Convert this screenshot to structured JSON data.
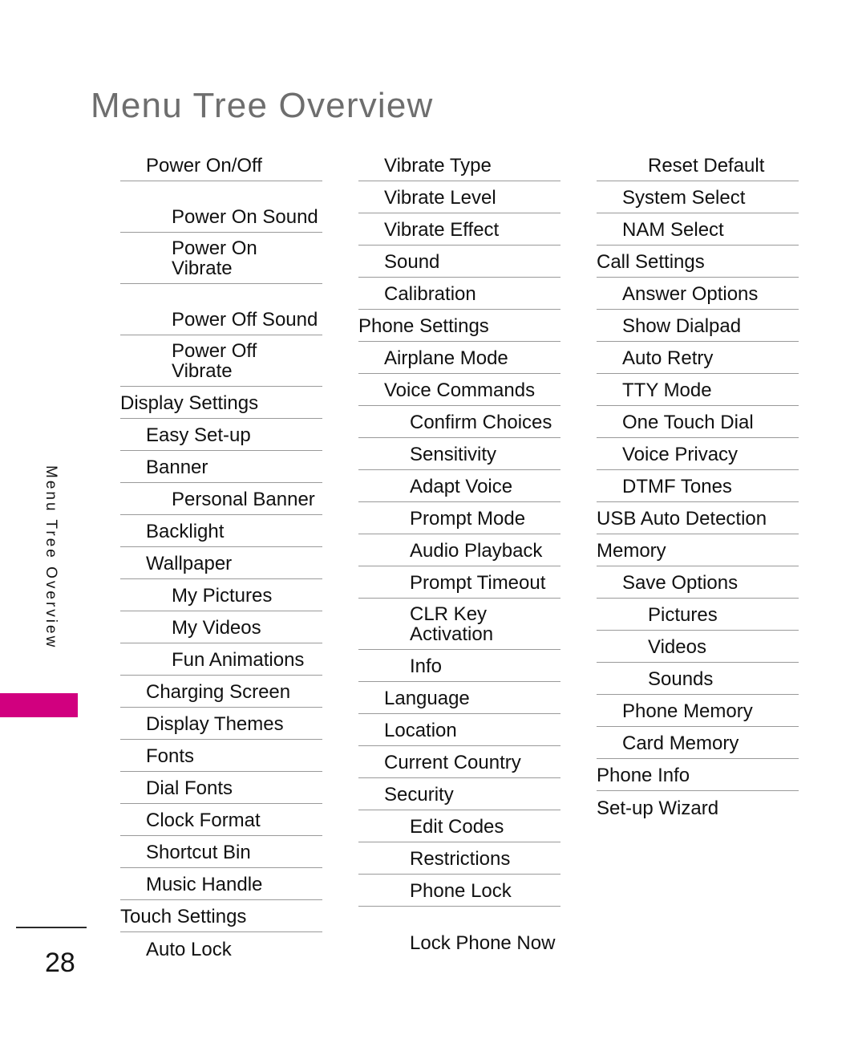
{
  "page": {
    "title": "Menu Tree Overview",
    "number": "28",
    "sidebar_label": "Menu Tree Overview",
    "accent_color": "#d1007f",
    "title_color": "#6e6e6e",
    "rule_color": "#9a9a9a"
  },
  "columns": [
    {
      "name": "column-1",
      "items": [
        {
          "label": "Power On/Off",
          "level": 1,
          "lines": 1
        },
        {
          "label": "Power On Sound",
          "level": 2,
          "lines": 2
        },
        {
          "label": "Power On Vibrate",
          "level": 2,
          "lines": 2
        },
        {
          "label": "Power Off Sound",
          "level": 2,
          "lines": 2
        },
        {
          "label": "Power Off Vibrate",
          "level": 2,
          "lines": 2
        },
        {
          "label": "Display Settings",
          "level": 0,
          "lines": 1
        },
        {
          "label": "Easy Set-up",
          "level": 1,
          "lines": 1
        },
        {
          "label": "Banner",
          "level": 1,
          "lines": 1
        },
        {
          "label": "Personal Banner",
          "level": 2,
          "lines": 1
        },
        {
          "label": "Backlight",
          "level": 1,
          "lines": 1
        },
        {
          "label": "Wallpaper",
          "level": 1,
          "lines": 1
        },
        {
          "label": "My Pictures",
          "level": 2,
          "lines": 1
        },
        {
          "label": "My Videos",
          "level": 2,
          "lines": 1
        },
        {
          "label": "Fun Animations",
          "level": 2,
          "lines": 1
        },
        {
          "label": "Charging Screen",
          "level": 1,
          "lines": 1
        },
        {
          "label": "Display Themes",
          "level": 1,
          "lines": 1
        },
        {
          "label": "Fonts",
          "level": 1,
          "lines": 1
        },
        {
          "label": "Dial Fonts",
          "level": 1,
          "lines": 1
        },
        {
          "label": "Clock Format",
          "level": 1,
          "lines": 1
        },
        {
          "label": "Shortcut Bin",
          "level": 1,
          "lines": 1
        },
        {
          "label": "Music Handle",
          "level": 1,
          "lines": 1
        },
        {
          "label": "Touch Settings",
          "level": 0,
          "lines": 1
        },
        {
          "label": "Auto Lock",
          "level": 1,
          "lines": 1
        }
      ]
    },
    {
      "name": "column-2",
      "items": [
        {
          "label": "Vibrate Type",
          "level": 1,
          "lines": 1
        },
        {
          "label": "Vibrate Level",
          "level": 1,
          "lines": 1
        },
        {
          "label": "Vibrate Effect",
          "level": 1,
          "lines": 1
        },
        {
          "label": "Sound",
          "level": 1,
          "lines": 1
        },
        {
          "label": "Calibration",
          "level": 1,
          "lines": 1
        },
        {
          "label": "Phone Settings",
          "level": 0,
          "lines": 1
        },
        {
          "label": "Airplane Mode",
          "level": 1,
          "lines": 1
        },
        {
          "label": "Voice Commands",
          "level": 1,
          "lines": 1
        },
        {
          "label": "Confirm Choices",
          "level": 2,
          "lines": 1
        },
        {
          "label": "Sensitivity",
          "level": 2,
          "lines": 1
        },
        {
          "label": "Adapt Voice",
          "level": 2,
          "lines": 1
        },
        {
          "label": "Prompt Mode",
          "level": 2,
          "lines": 1
        },
        {
          "label": "Audio Playback",
          "level": 2,
          "lines": 1
        },
        {
          "label": "Prompt Timeout",
          "level": 2,
          "lines": 1
        },
        {
          "label": "CLR Key Activation",
          "level": 2,
          "lines": 2
        },
        {
          "label": "Info",
          "level": 2,
          "lines": 1
        },
        {
          "label": "Language",
          "level": 1,
          "lines": 1
        },
        {
          "label": "Location",
          "level": 1,
          "lines": 1
        },
        {
          "label": "Current Country",
          "level": 1,
          "lines": 1
        },
        {
          "label": "Security",
          "level": 1,
          "lines": 1
        },
        {
          "label": "Edit Codes",
          "level": 2,
          "lines": 1
        },
        {
          "label": "Restrictions",
          "level": 2,
          "lines": 1
        },
        {
          "label": "Phone Lock",
          "level": 2,
          "lines": 1
        },
        {
          "label": "Lock Phone Now",
          "level": 2,
          "lines": 2
        }
      ]
    },
    {
      "name": "column-3",
      "items": [
        {
          "label": "Reset Default",
          "level": 2,
          "lines": 1
        },
        {
          "label": "System Select",
          "level": 1,
          "lines": 1
        },
        {
          "label": "NAM Select",
          "level": 1,
          "lines": 1
        },
        {
          "label": "Call Settings",
          "level": 0,
          "lines": 1
        },
        {
          "label": "Answer Options",
          "level": 1,
          "lines": 1
        },
        {
          "label": "Show Dialpad",
          "level": 1,
          "lines": 1
        },
        {
          "label": "Auto Retry",
          "level": 1,
          "lines": 1
        },
        {
          "label": "TTY Mode",
          "level": 1,
          "lines": 1
        },
        {
          "label": "One Touch Dial",
          "level": 1,
          "lines": 1
        },
        {
          "label": "Voice Privacy",
          "level": 1,
          "lines": 1
        },
        {
          "label": "DTMF Tones",
          "level": 1,
          "lines": 1
        },
        {
          "label": "USB Auto Detection",
          "level": 0,
          "lines": 1
        },
        {
          "label": "Memory",
          "level": 0,
          "lines": 1
        },
        {
          "label": "Save Options",
          "level": 1,
          "lines": 1
        },
        {
          "label": "Pictures",
          "level": 2,
          "lines": 1
        },
        {
          "label": "Videos",
          "level": 2,
          "lines": 1
        },
        {
          "label": "Sounds",
          "level": 2,
          "lines": 1
        },
        {
          "label": "Phone Memory",
          "level": 1,
          "lines": 1
        },
        {
          "label": "Card Memory",
          "level": 1,
          "lines": 1
        },
        {
          "label": "Phone Info",
          "level": 0,
          "lines": 1
        },
        {
          "label": "Set-up Wizard",
          "level": 0,
          "lines": 1
        }
      ]
    }
  ]
}
